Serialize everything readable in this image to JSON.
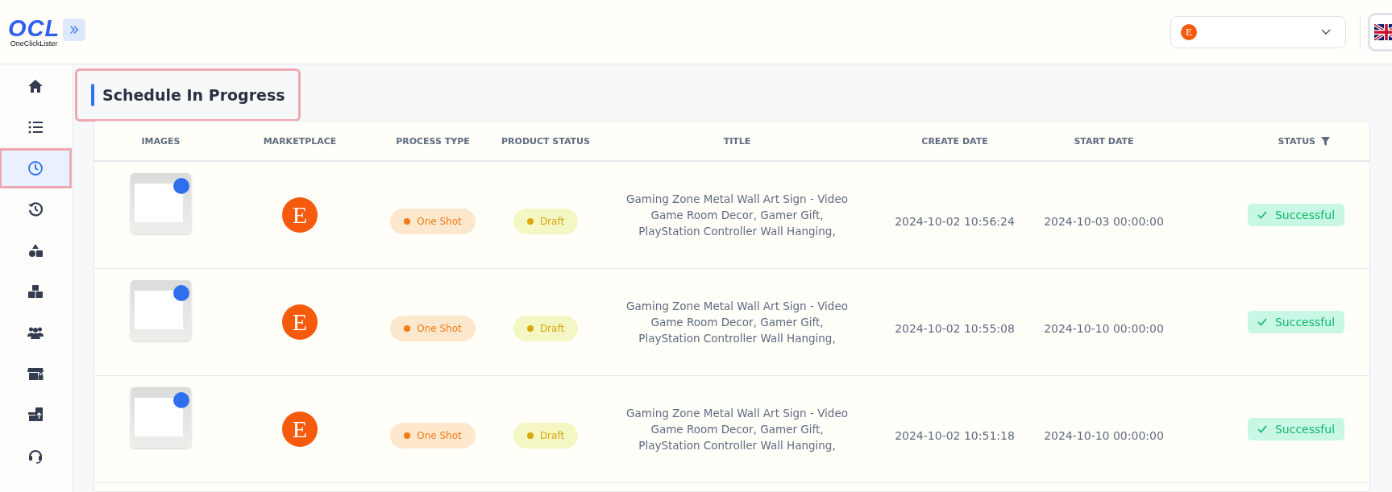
{
  "logo": {
    "mark": "OCL",
    "name": "OneClickLister"
  },
  "header": {
    "marketplace_select": {
      "letter": "E"
    }
  },
  "sidebar": {
    "items": [
      {
        "selected": false
      },
      {
        "selected": false
      },
      {
        "selected": true
      },
      {
        "selected": false
      },
      {
        "selected": false
      },
      {
        "selected": false
      },
      {
        "selected": false
      },
      {
        "selected": false
      },
      {
        "selected": false
      },
      {
        "selected": false
      }
    ]
  },
  "page_title": "Schedule In Progress",
  "table": {
    "columns": [
      "IMAGES",
      "MARKETPLACE",
      "PROCESS TYPE",
      "PRODUCT STATUS",
      "TITLE",
      "CREATE DATE",
      "START DATE",
      "STATUS"
    ],
    "rows": [
      {
        "marketplace": "E",
        "process_type": {
          "kind": "one_shot",
          "label": "One Shot"
        },
        "product_status": {
          "kind": "draft",
          "label": "Draft"
        },
        "title": "Gaming Zone Metal Wall Art Sign - Video Game Room Decor, Gamer Gift, PlayStation Controller Wall Hanging,",
        "create_date": "2024-10-02 10:56:24",
        "start_date": "2024-10-03 00:00:00",
        "status": {
          "kind": "success",
          "label": "Successful"
        }
      },
      {
        "marketplace": "E",
        "process_type": {
          "kind": "one_shot",
          "label": "One Shot"
        },
        "product_status": {
          "kind": "draft",
          "label": "Draft"
        },
        "title": "Gaming Zone Metal Wall Art Sign - Video Game Room Decor, Gamer Gift, PlayStation Controller Wall Hanging,",
        "create_date": "2024-10-02 10:55:08",
        "start_date": "2024-10-10 00:00:00",
        "status": {
          "kind": "success",
          "label": "Successful"
        }
      },
      {
        "marketplace": "E",
        "process_type": {
          "kind": "one_shot",
          "label": "One Shot"
        },
        "product_status": {
          "kind": "draft",
          "label": "Draft"
        },
        "title": "Gaming Zone Metal Wall Art Sign - Video Game Room Decor, Gamer Gift, PlayStation Controller Wall Hanging,",
        "create_date": "2024-10-02 10:51:18",
        "start_date": "2024-10-10 00:00:00",
        "status": {
          "kind": "success",
          "label": "Successful"
        }
      }
    ]
  }
}
